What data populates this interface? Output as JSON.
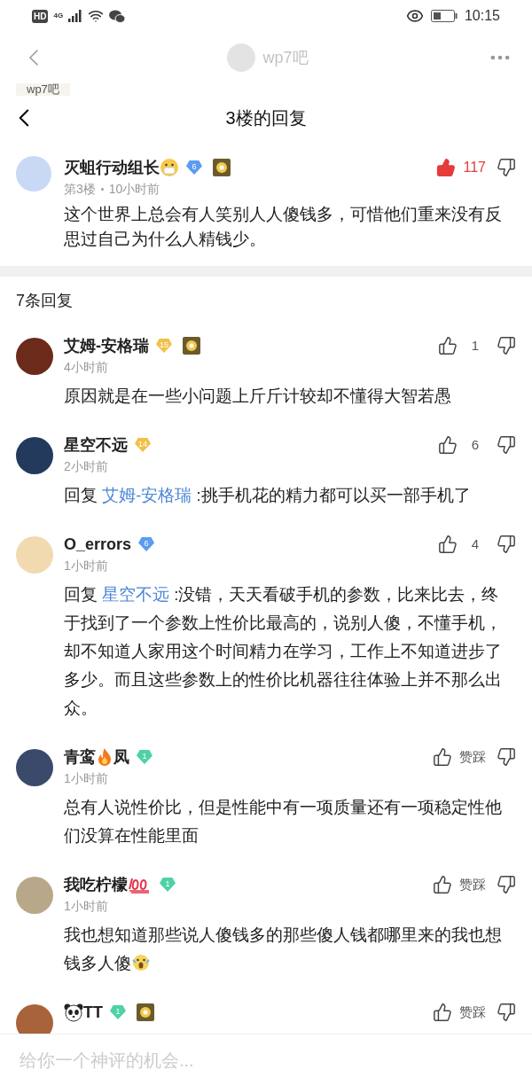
{
  "status_bar": {
    "hd": "HD",
    "network": "4G",
    "time": "10:15"
  },
  "faded_header": {
    "title": "wp7吧",
    "tag": "wp7吧"
  },
  "header": {
    "title": "3楼的回复"
  },
  "post": {
    "name": [
      {
        "kind": "text",
        "text": "灭蛆行动组长"
      },
      {
        "kind": "mask"
      }
    ],
    "badge": {
      "level": "6",
      "color": "#5b9cf0"
    },
    "medal": true,
    "floor": "第3楼",
    "time": "10小时前",
    "likes": "117",
    "liked": true,
    "body": "这个世界上总会有人笑别人人傻钱多，可惜他们重来没有反思过自己为什么人精钱少。"
  },
  "reply_count": "7条回复",
  "replies": [
    {
      "name": [
        {
          "kind": "text",
          "text": "艾姆-安格瑞"
        }
      ],
      "badge": {
        "level": "15",
        "color": "#f2c04a"
      },
      "medal": true,
      "time": "4小时前",
      "likes": "1",
      "liked": false,
      "body": "原因就是在一些小问题上斤斤计较却不懂得大智若愚"
    },
    {
      "name": [
        {
          "kind": "text",
          "text": "星空不远"
        }
      ],
      "badge": {
        "level": "14",
        "color": "#f2c04a"
      },
      "time": "2小时前",
      "likes": "6",
      "liked": false,
      "reply_prefix": "回复",
      "reply_to": "艾姆-安格瑞",
      "body": ":挑手机花的精力都可以买一部手机了"
    },
    {
      "name": [
        {
          "kind": "text",
          "text": "O_errors"
        }
      ],
      "badge": {
        "level": "6",
        "color": "#5b9cf0"
      },
      "time": "1小时前",
      "likes": "4",
      "liked": false,
      "reply_prefix": "回复",
      "reply_to": "星空不远",
      "body": ":没错，天天看破手机的参数，比来比去，终于找到了一个参数上性价比最高的，说别人傻，不懂手机，却不知道人家用这个时间精力在学习，工作上不知道进步了多少。而且这些参数上的性价比机器往往体验上并不那么出众。"
    },
    {
      "name": [
        {
          "kind": "text",
          "text": "青鸾"
        },
        {
          "kind": "fire"
        },
        {
          "kind": "text",
          "text": "凤"
        }
      ],
      "badge": {
        "level": "1",
        "color": "#4fd1a5"
      },
      "time": "1小时前",
      "likes": "赞踩",
      "liked": false,
      "body": "总有人说性价比，但是性能中有一项质量还有一项稳定性他们没算在性能里面"
    },
    {
      "name": [
        {
          "kind": "text",
          "text": "我吃柠檬"
        },
        {
          "kind": "hundred"
        }
      ],
      "badge": {
        "level": "1",
        "color": "#4fd1a5"
      },
      "time": "1小时前",
      "likes": "赞踩",
      "liked": false,
      "body": "我也想知道那些说人傻钱多的那些傻人钱都哪里来的我也想钱多人傻",
      "body_end": {
        "kind": "scream"
      }
    },
    {
      "name": [
        {
          "kind": "panda"
        },
        {
          "kind": "text",
          "text": "TT"
        }
      ],
      "badge": {
        "level": "1",
        "color": "#4fd1a5"
      },
      "medal": true,
      "likes": "赞踩",
      "liked": false
    }
  ],
  "input": {
    "placeholder": "给你一个神评的机会..."
  }
}
